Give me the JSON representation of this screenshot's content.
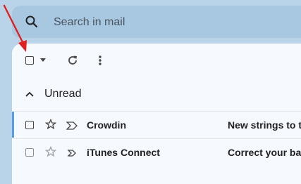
{
  "search": {
    "placeholder": "Search in mail"
  },
  "toolbar": {
    "select_icon": "checkbox-icon",
    "select_menu_icon": "caret-down-icon",
    "refresh_icon": "refresh-icon",
    "more_icon": "more-vert-icon"
  },
  "section": {
    "title": "Unread",
    "icon": "chevron-up-icon"
  },
  "emails": [
    {
      "sender": "Crowdin",
      "subject": "New strings to t"
    },
    {
      "sender": "iTunes Connect",
      "subject": "Correct your ba"
    }
  ],
  "annotation": {
    "icon": "red-arrow-pointer",
    "color": "#e02020"
  }
}
